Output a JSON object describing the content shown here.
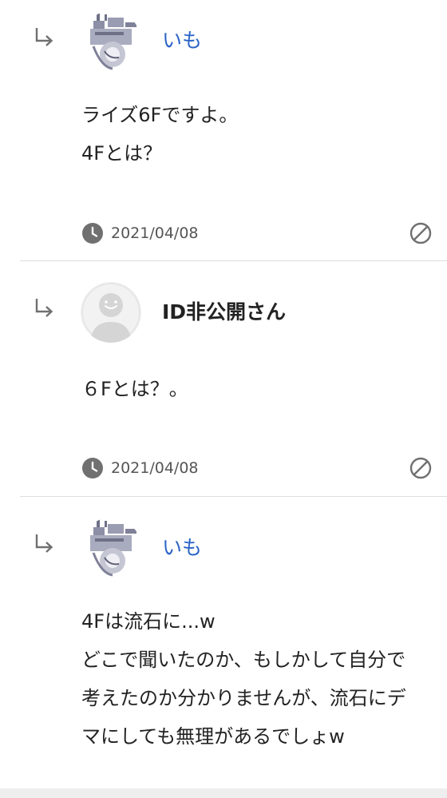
{
  "replies": [
    {
      "user": "いも",
      "lines": [
        "ライズ6Fですよ。",
        "4Fとは？"
      ],
      "date": "2021/04/08"
    },
    {
      "user": "ID非公開さん",
      "lines": [
        "６Fとは？。"
      ],
      "date": "2021/04/08"
    },
    {
      "user": "いも",
      "lines": [
        "4Fは流石に...w",
        "どこで聞いたのか、もしかして自分で",
        "考えたのか分かりませんが、流石にデ",
        "マにしても無理があるでしょw"
      ]
    }
  ],
  "icons": {
    "reply_arrow": "reply-arrow-icon",
    "clock": "clock-icon",
    "report": "prohibited-icon",
    "anon_avatar": "default-user-icon"
  },
  "colors": {
    "link_name": "#2b63c6",
    "text": "#222222",
    "meta_text": "#555555",
    "icon_gray": "#707070",
    "divider": "#dddddd"
  }
}
